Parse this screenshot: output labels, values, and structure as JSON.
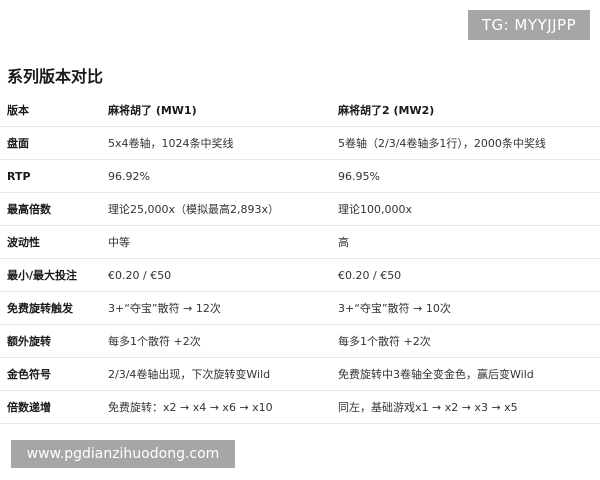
{
  "watermark_top": "TG: MYYJJPP",
  "section_title": "系列版本对比",
  "table": {
    "headers": [
      "版本",
      "麻将胡了 (MW1)",
      "麻将胡了2 (MW2)"
    ],
    "rows": [
      [
        "盘面",
        "5x4卷轴，1024条中奖线",
        "5卷轴（2/3/4卷轴多1行），2000条中奖线"
      ],
      [
        "RTP",
        "96.92%",
        "96.95%"
      ],
      [
        "最高倍数",
        "理论25,000x（模拟最高2,893x）",
        "理论100,000x"
      ],
      [
        "波动性",
        "中等",
        "高"
      ],
      [
        "最小/最大投注",
        "€0.20 / €50",
        "€0.20 / €50"
      ],
      [
        "免费旋转触发",
        "3+“夺宝”散符 → 12次",
        "3+“夺宝”散符 → 10次"
      ],
      [
        "额外旋转",
        "每多1个散符 +2次",
        "每多1个散符 +2次"
      ],
      [
        "金色符号",
        "2/3/4卷轴出现，下次旋转变Wild",
        "免费旋转中3卷轴全变金色，赢后变Wild"
      ],
      [
        "倍数递增",
        "免费旋转：x2 → x4 → x6 → x10",
        "同左，基础游戏x1 → x2 → x3 → x5"
      ]
    ]
  },
  "watermark_bottom": "www.pgdianzihuodong.com"
}
